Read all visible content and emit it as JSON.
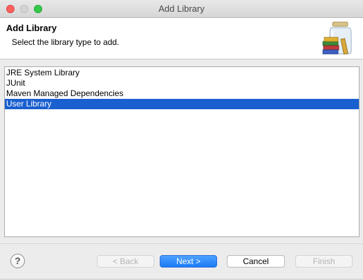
{
  "window": {
    "title": "Add Library"
  },
  "header": {
    "title": "Add Library",
    "subtitle": "Select the library type to add.",
    "icon": "library-jar-books-icon"
  },
  "library_list": {
    "items": [
      {
        "label": "JRE System Library",
        "selected": false
      },
      {
        "label": "JUnit",
        "selected": false
      },
      {
        "label": "Maven Managed Dependencies",
        "selected": false
      },
      {
        "label": "User Library",
        "selected": true
      }
    ]
  },
  "footer": {
    "help_label": "?",
    "back_label": "< Back",
    "next_label": "Next >",
    "cancel_label": "Cancel",
    "finish_label": "Finish"
  },
  "colors": {
    "selection": "#1a5fcf",
    "default_button": "#1b7cf5"
  }
}
